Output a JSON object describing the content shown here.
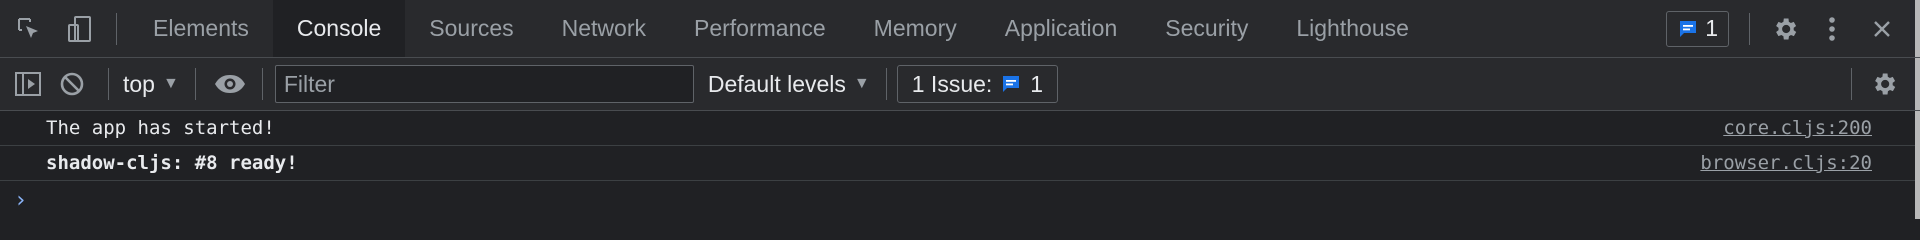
{
  "tabs": [
    {
      "label": "Elements",
      "active": false
    },
    {
      "label": "Console",
      "active": true
    },
    {
      "label": "Sources",
      "active": false
    },
    {
      "label": "Network",
      "active": false
    },
    {
      "label": "Performance",
      "active": false
    },
    {
      "label": "Memory",
      "active": false
    },
    {
      "label": "Application",
      "active": false
    },
    {
      "label": "Security",
      "active": false
    },
    {
      "label": "Lighthouse",
      "active": false
    }
  ],
  "header": {
    "issues_count": "1",
    "icons": [
      "inspect-element-icon",
      "device-toolbar-icon",
      "message-icon",
      "settings-icon",
      "more-vertical-icon",
      "close-icon"
    ]
  },
  "toolbar": {
    "context": "top",
    "filter_placeholder": "Filter",
    "levels": "Default levels",
    "issue_label": "1 Issue:",
    "issue_count": "1",
    "icons": [
      "sidebar-toggle-icon",
      "clear-console-icon",
      "eye-icon",
      "settings-icon"
    ]
  },
  "console": {
    "lines": [
      {
        "text": "The app has started!",
        "source": "core.cljs:200"
      },
      {
        "text": "shadow-cljs: #8 ready!",
        "source": "browser.cljs:20"
      }
    ],
    "prompt": "›"
  },
  "colors": {
    "accent": "#1a73e8",
    "link": "#8ab4f8",
    "background": "#202124",
    "toolbar": "#292a2d"
  }
}
